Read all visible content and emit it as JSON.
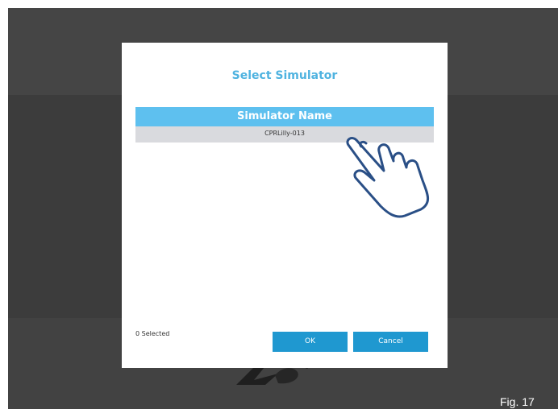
{
  "dialog": {
    "title": "Select Simulator",
    "table": {
      "header": "Simulator Name",
      "rows": [
        "CPRLilly-013"
      ]
    },
    "selected_count": "0 Selected",
    "ok_label": "OK",
    "cancel_label": "Cancel"
  },
  "figure_label": "Fig. 17",
  "colors": {
    "accent": "#5ec0ef",
    "button": "#1f98d0",
    "title": "#4fb3e0",
    "row_selected": "#d9dade",
    "overlay": "#3a3a3a"
  },
  "icons": [
    "pointing-hand-icon",
    "brand-logo"
  ]
}
